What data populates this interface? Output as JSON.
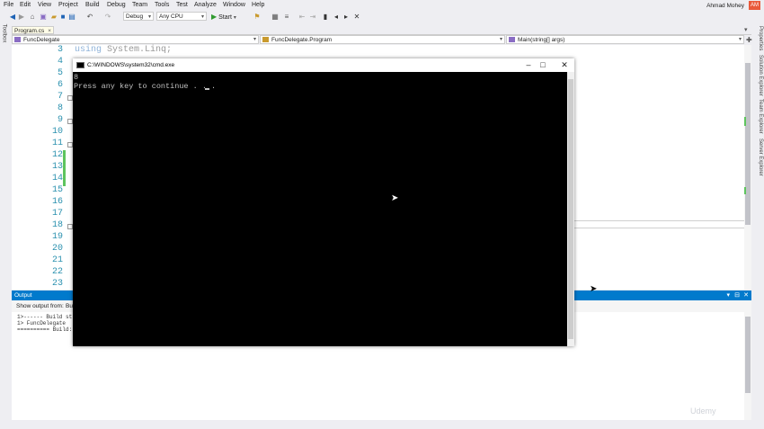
{
  "menu": [
    "File",
    "Edit",
    "View",
    "Project",
    "Build",
    "Debug",
    "Team",
    "Tools",
    "Test",
    "Analyze",
    "Window",
    "Help"
  ],
  "user": {
    "name": "Ahmad Mohey",
    "initials": "AM"
  },
  "toolbar": {
    "config": "Debug",
    "platform": "Any CPU",
    "start_label": "Start"
  },
  "toolbox_label": "Toolbox",
  "right_tabs": [
    "Properties",
    "Solution Explorer",
    "Team Explorer",
    "Server Explorer"
  ],
  "document_tab": {
    "label": "Program.cs",
    "close": "×"
  },
  "navbar": {
    "project": "FuncDelegate",
    "type": "FuncDelegate.Program",
    "member": "Main(string[] args)"
  },
  "editor": {
    "line_numbers": [
      "3",
      "4",
      "5",
      "6",
      "7",
      "8",
      "9",
      "10",
      "11",
      "12",
      "13",
      "14",
      "15",
      "16",
      "17",
      "18",
      "19",
      "20",
      "21",
      "22",
      "23"
    ],
    "visible_code": {
      "keyword": "using",
      "rest": " System.Linq;"
    }
  },
  "output": {
    "title": "Output",
    "show_from_label": "Show output from:",
    "show_from_value": "Bu",
    "lines": [
      "1>------ Build st",
      "1>  FuncDelegate",
      "========== Build:"
    ]
  },
  "console": {
    "title": "C:\\WINDOWS\\system32\\cmd.exe",
    "lines": [
      "8",
      "Press any key to continue . . ."
    ]
  },
  "watermark": "Udemy",
  "colors": {
    "accent": "#007acc",
    "console_bg": "#000000",
    "line_number": "#2b91af",
    "change_marker": "#5ec45e"
  }
}
